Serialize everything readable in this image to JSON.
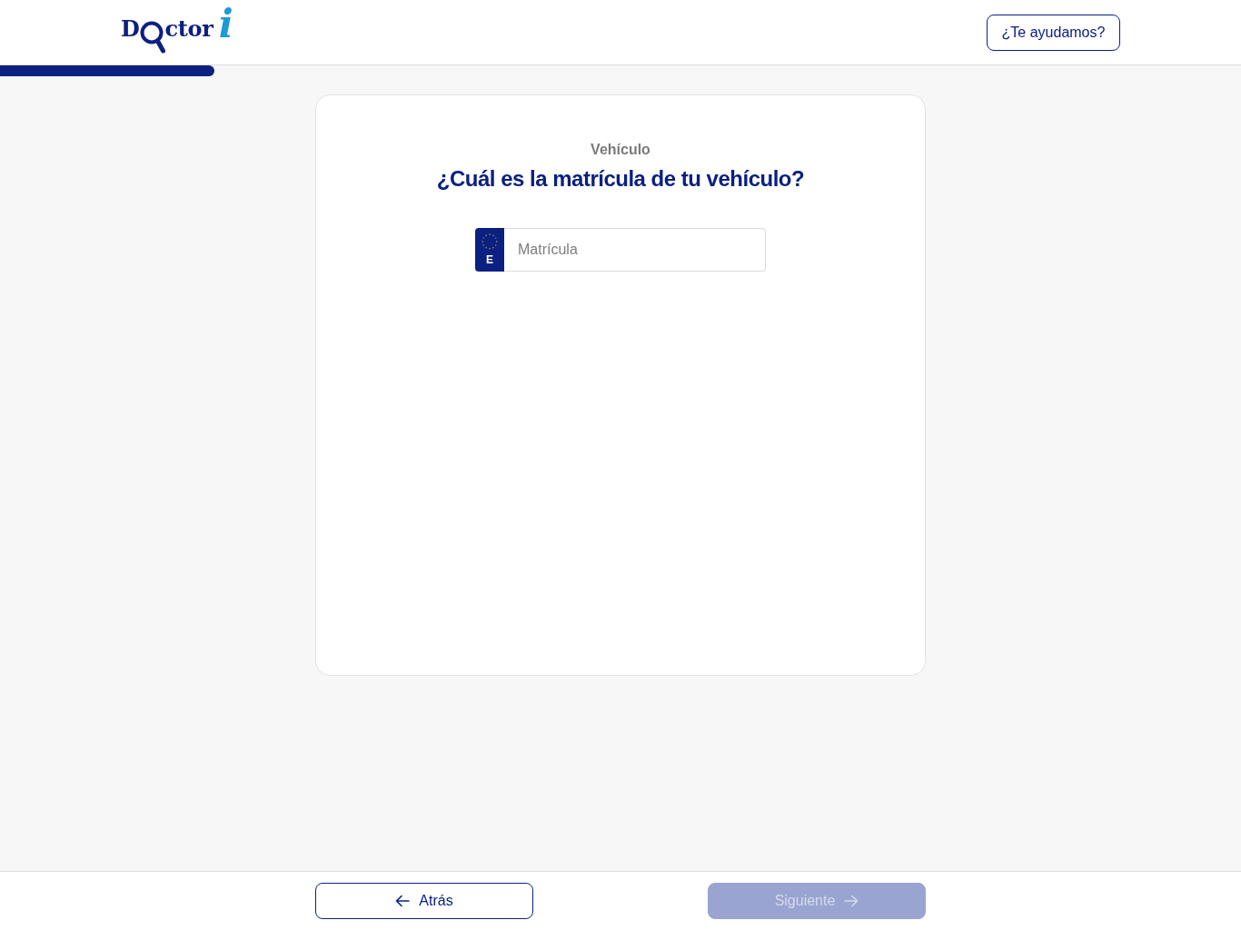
{
  "header": {
    "logo": {
      "lead": "D",
      "tail": "ctor",
      "mark": "i"
    },
    "help_button": "¿Te ayudamos?"
  },
  "progress": {
    "level": 0.173
  },
  "card": {
    "section": "Vehículo",
    "question": "¿Cuál es la matrícula de tu vehículo?",
    "plate_field": {
      "country": "E",
      "placeholder": "Matrícula"
    }
  },
  "footer": {
    "buttons": [
      {
        "label": "Atrás",
        "kind": "back",
        "disabled": false
      },
      {
        "label": "Siguiente",
        "kind": "next",
        "disabled": true
      }
    ]
  }
}
